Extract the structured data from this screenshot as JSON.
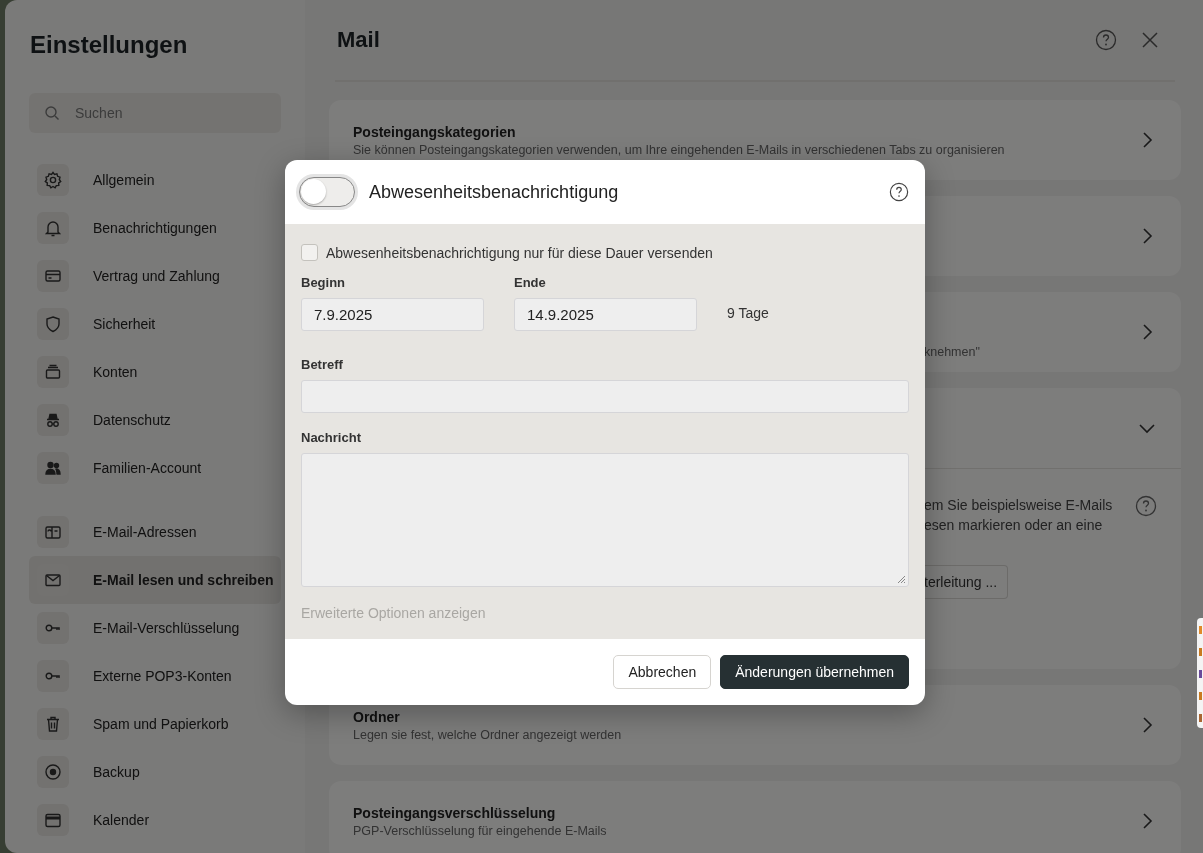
{
  "sidebar": {
    "title": "Einstellungen",
    "search": {
      "placeholder": "Suchen"
    },
    "groups": [
      [
        {
          "label": "Allgemein",
          "selected": false
        },
        {
          "label": "Benachrichtigungen",
          "selected": false
        },
        {
          "label": "Vertrag und Zahlung",
          "selected": false
        },
        {
          "label": "Sicherheit",
          "selected": false
        },
        {
          "label": "Konten",
          "selected": false
        },
        {
          "label": "Datenschutz",
          "selected": false
        },
        {
          "label": "Familien-Account",
          "selected": false
        }
      ],
      [
        {
          "label": "E-Mail-Adressen",
          "selected": false
        },
        {
          "label": "E-Mail lesen und schreiben",
          "selected": true
        },
        {
          "label": "E-Mail-Verschlüsselung",
          "selected": false
        },
        {
          "label": "Externe POP3-Konten",
          "selected": false
        },
        {
          "label": "Spam und Papierkorb",
          "selected": false
        },
        {
          "label": "Backup",
          "selected": false
        },
        {
          "label": "Kalender",
          "selected": false
        }
      ]
    ]
  },
  "main": {
    "title": "Mail",
    "cards": [
      {
        "kind": "link",
        "title": "Posteingangskategorien",
        "subtitle": "Sie können Posteingangskategorien verwenden, um Ihre eingehenden E-Mails in verschiedenen Tabs zu organisieren",
        "expanded": false
      },
      {
        "kind": "hidden",
        "expanded": false
      },
      {
        "kind": "hidden",
        "fragment": "knehmen\"",
        "expanded": false
      },
      {
        "kind": "hidden",
        "expanded": true,
        "body_lines": [
          "em Sie beispielsweise E-Mails",
          "esen markieren oder an eine"
        ],
        "button": "terleitung ..."
      },
      {
        "kind": "link",
        "title": "Ordner",
        "subtitle": "Legen sie fest, welche Ordner angezeigt werden",
        "expanded": false
      },
      {
        "kind": "link",
        "title": "Posteingangsverschlüsselung",
        "subtitle": "PGP-Verschlüsselung für eingehende E-Mails",
        "expanded": false
      }
    ]
  },
  "dialog": {
    "title": "Abwesenheitsbenachrichtigung",
    "toggle": {
      "on": false
    },
    "limit": {
      "label": "Abwesenheitsbenachrichtigung nur für diese Dauer versenden",
      "checked": false
    },
    "start": {
      "label": "Beginn",
      "value": "7.9.2025"
    },
    "end": {
      "label": "Ende",
      "value": "14.9.2025"
    },
    "duration": "9 Tage",
    "subject": {
      "label": "Betreff"
    },
    "message": {
      "label": "Nachricht"
    },
    "advanced": "Erweiterte Optionen anzeigen",
    "buttons": {
      "cancel": "Abbrechen",
      "apply": "Änderungen übernehmen"
    }
  }
}
